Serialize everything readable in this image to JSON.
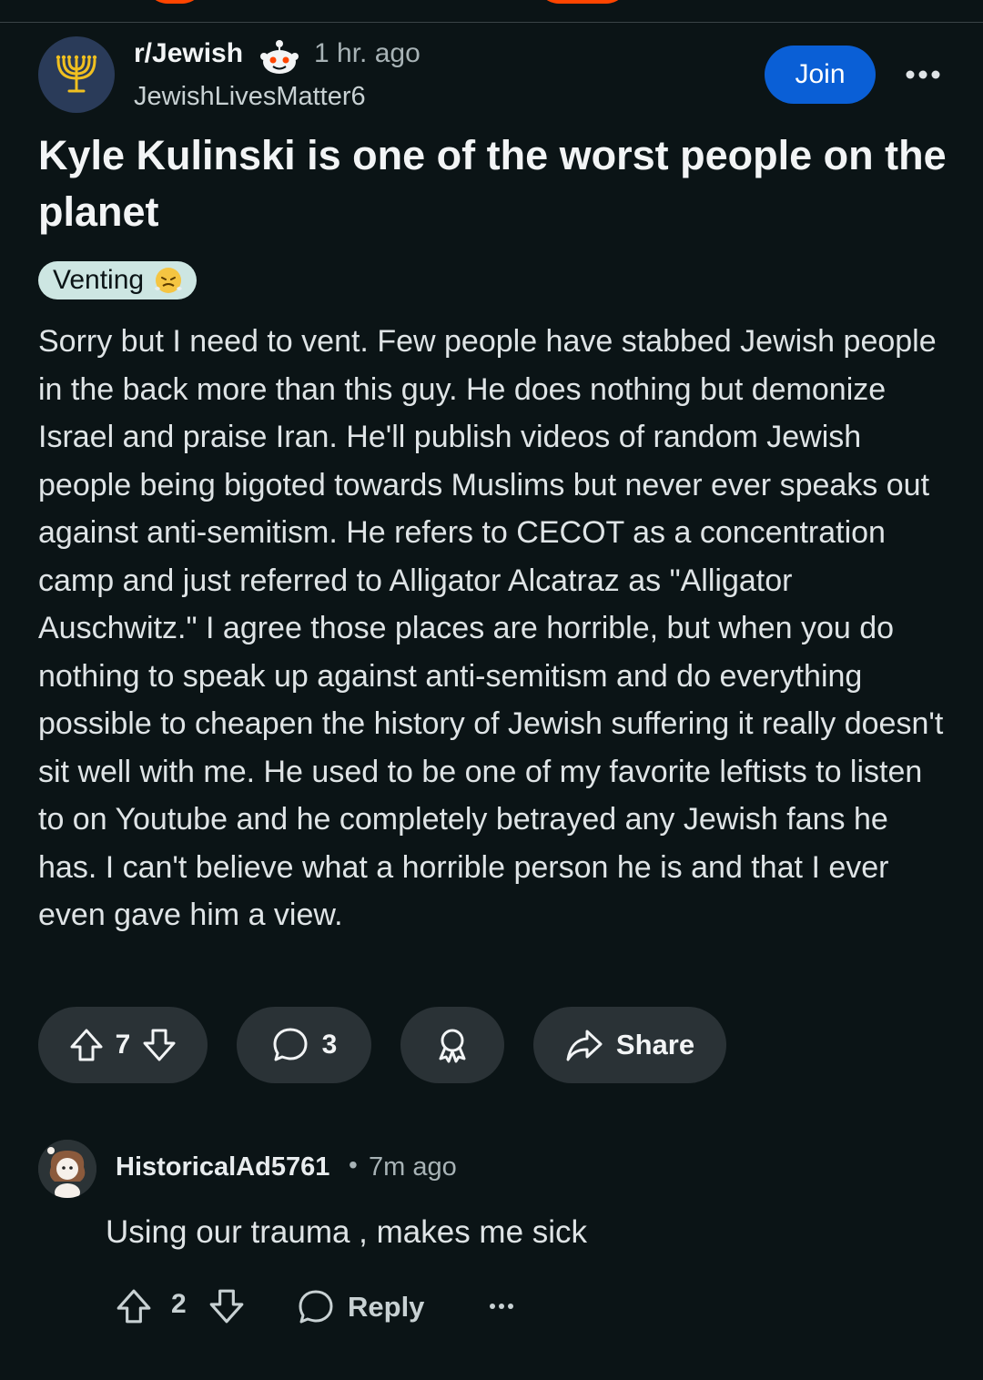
{
  "post": {
    "subreddit": "r/Jewish",
    "time": "1 hr. ago",
    "author": "JewishLivesMatter6",
    "join_label": "Join",
    "title": "Kyle Kulinski is one of the worst people on the planet",
    "flair": "Venting",
    "body": "Sorry but I need to vent. Few people have stabbed Jewish people in the back more than this guy. He does nothing but demonize Israel and praise Iran. He'll publish videos of random Jewish people being bigoted towards Muslims but never ever speaks out against anti-semitism. He refers to CECOT as a concentration camp and just referred to Alligator Alcatraz as \"Alligator Auschwitz.\" I agree those places are horrible, but when you do nothing to speak up against anti-semitism and do everything possible to cheapen the history of Jewish suffering it really doesn't sit well with me. He used to be one of my favorite leftists to listen to on Youtube and he completely betrayed any Jewish fans he has. I can't believe what a horrible person he is and that I ever even gave him a view.",
    "votes": "7",
    "comments": "3",
    "share_label": "Share"
  },
  "comment": {
    "user": "HistoricalAd5761",
    "separator": "•",
    "time": "7m ago",
    "text": "Using our trauma , makes me sick",
    "votes": "2",
    "reply_label": "Reply"
  },
  "icons": {
    "subreddit_avatar": "menorah-icon",
    "mod_badge": "snoo-icon",
    "more": "more-icon",
    "flair_emoji": "steam-face-icon",
    "upvote": "upvote-icon",
    "downvote": "downvote-icon",
    "comment": "comment-icon",
    "award": "award-icon",
    "share": "share-icon"
  },
  "colors": {
    "background": "#0b1416",
    "join_button": "#0a5fd6",
    "pill": "#2a3236",
    "flair_bg": "#cde6e2",
    "accent_orange": "#ff4500"
  }
}
